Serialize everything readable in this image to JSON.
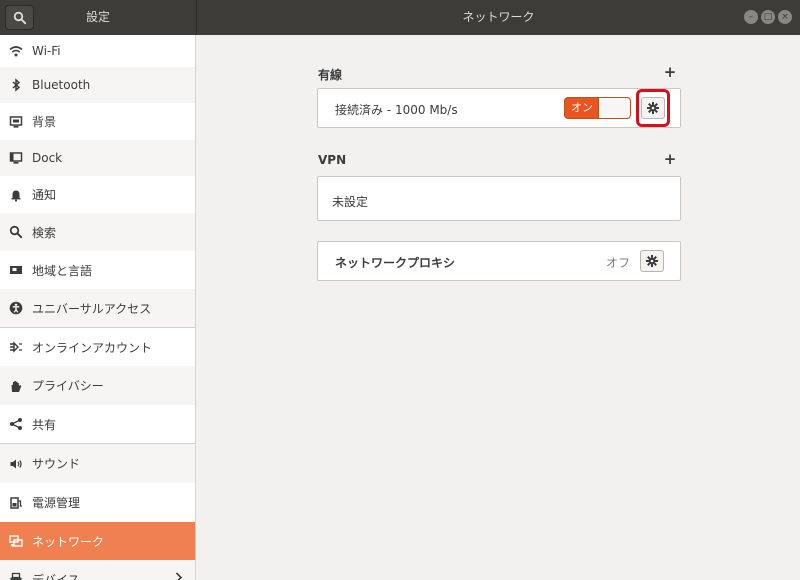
{
  "header": {
    "left_title": "設定",
    "title": "ネットワーク",
    "search_icon": "search-icon",
    "window_controls": [
      "minimize-icon",
      "maximize-icon",
      "close-icon"
    ]
  },
  "sidebar": {
    "items": [
      {
        "label": "Wi-Fi",
        "icon": "wifi-icon"
      },
      {
        "label": "Bluetooth",
        "icon": "bluetooth-icon"
      },
      {
        "label": "背景",
        "icon": "background-icon"
      },
      {
        "label": "Dock",
        "icon": "dock-icon"
      },
      {
        "label": "通知",
        "icon": "bell-icon"
      },
      {
        "label": "検索",
        "icon": "search-icon"
      },
      {
        "label": "地域と言語",
        "icon": "region-icon"
      },
      {
        "label": "ユニバーサルアクセス",
        "icon": "accessibility-icon"
      },
      {
        "label": "オンラインアカウント",
        "icon": "online-accounts-icon"
      },
      {
        "label": "プライバシー",
        "icon": "hand-icon"
      },
      {
        "label": "共有",
        "icon": "share-icon"
      },
      {
        "label": "サウンド",
        "icon": "speaker-icon"
      },
      {
        "label": "電源管理",
        "icon": "power-icon"
      },
      {
        "label": "ネットワーク",
        "icon": "network-icon",
        "selected": true
      },
      {
        "label": "デバイス",
        "icon": "printer-icon"
      }
    ]
  },
  "main": {
    "wired": {
      "title": "有線",
      "status": "接続済み - 1000 Mb/s",
      "switch_label": "オン",
      "accent_color": "#e95420"
    },
    "vpn": {
      "title": "VPN",
      "status": "未設定"
    },
    "proxy": {
      "title": "ネットワークプロキシ",
      "status": "オフ"
    }
  },
  "colors": {
    "headerbar": "#3d3c38",
    "selected": "#f08050",
    "highlight": "#d4111e"
  }
}
